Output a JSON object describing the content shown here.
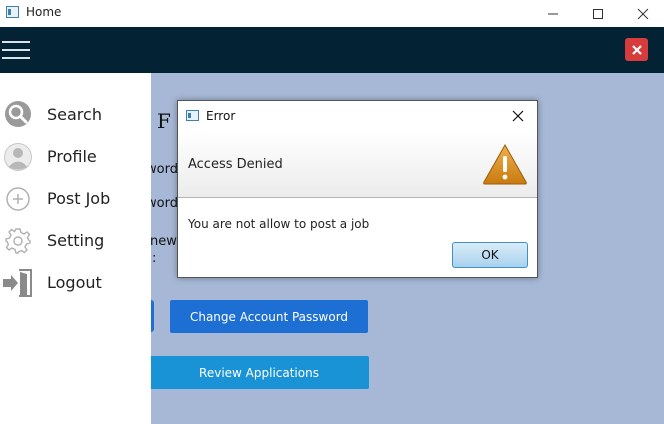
{
  "window": {
    "title": "Home",
    "icon": "app-window-icon",
    "controls": [
      "minimize-icon",
      "maximize-icon",
      "close-icon"
    ]
  },
  "appbar": {
    "menu_icon": "hamburger-menu-icon",
    "close_icon": "close-icon",
    "background": "#032335",
    "close_color": "#d63c3c"
  },
  "sidebar": {
    "items": [
      {
        "label": "Search",
        "icon": "search-icon"
      },
      {
        "label": "Profile",
        "icon": "profile-icon"
      },
      {
        "label": "Post Job",
        "icon": "add-circle-icon"
      },
      {
        "label": "Setting",
        "icon": "gear-icon"
      },
      {
        "label": "Logout",
        "icon": "logout-icon"
      }
    ]
  },
  "main": {
    "background": "#a6b8d6",
    "partial_heading": "ge F",
    "partial_labels": [
      "word",
      "word",
      "new",
      ":"
    ],
    "buttons": {
      "change_password": "Change Account Password",
      "review_applications": "Review Applications"
    }
  },
  "dialog": {
    "title": "Error",
    "header_text": "Access Denied",
    "content_text": "You are not allow to post a job",
    "ok_label": "OK",
    "icon": "warning-icon",
    "warning_color": "#d9901a"
  }
}
